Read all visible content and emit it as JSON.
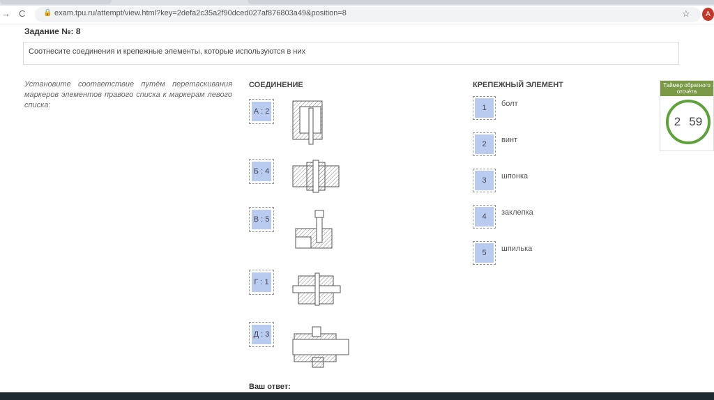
{
  "browser": {
    "url": "exam.tpu.ru/attempt/view.html?key=2defa2c35a2f90dced027af876803a49&position=8",
    "avatar": "A"
  },
  "task": {
    "title": "Задание №:  8",
    "question": "Соотнесите соединения и крепежные элементы, которые используются в них",
    "instruction": "Установите соответствие путём перетаскивания маркеров элементов правого списка к маркерам левого списка:"
  },
  "left": {
    "header": "СОЕДИНЕНИЕ",
    "items": [
      {
        "label": "А : 2"
      },
      {
        "label": "Б : 4"
      },
      {
        "label": "В : 5"
      },
      {
        "label": "Г : 1"
      },
      {
        "label": "Д : 3"
      }
    ]
  },
  "right": {
    "header": "КРЕПЕЖНЫЙ ЭЛЕМЕНТ",
    "items": [
      {
        "num": "1",
        "label": "болт"
      },
      {
        "num": "2",
        "label": "винт"
      },
      {
        "num": "3",
        "label": "шпонка"
      },
      {
        "num": "4",
        "label": "заклепка"
      },
      {
        "num": "5",
        "label": "шпилька"
      }
    ]
  },
  "timer": {
    "title": "Таймер обратного отсчёта",
    "minutes": "2",
    "seconds": "59",
    "color": "#5ea23a"
  },
  "answer_label": "Ваш ответ:"
}
